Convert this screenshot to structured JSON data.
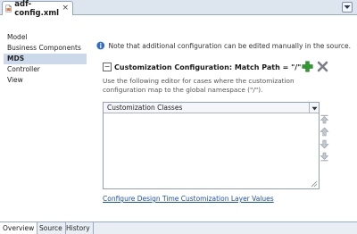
{
  "editor_tab": {
    "title": "adf-config.xml",
    "close_glyph": "×"
  },
  "nav": {
    "items": [
      "Model",
      "Business Components",
      "MDS",
      "Controller",
      "View"
    ],
    "selected": "MDS"
  },
  "note": {
    "text": "Note that additional configuration can be edited manually in the source."
  },
  "section": {
    "collapse_glyph": "−",
    "title": "Customization Configuration: Match Path = \"/\"",
    "description": "Use the following editor for cases where the customization configuration map to the global namespace (\"/\")."
  },
  "list": {
    "header": "Customization Classes"
  },
  "link": {
    "text": "Configure Design Time Customization Layer Values"
  },
  "bottom_tabs": [
    "Overview",
    "Source",
    "History"
  ],
  "colors": {
    "accent": "#1a4fb0",
    "add_green": "#2e9b2e",
    "selection": "#ccd9ea",
    "info_blue": "#2f6fc8"
  }
}
